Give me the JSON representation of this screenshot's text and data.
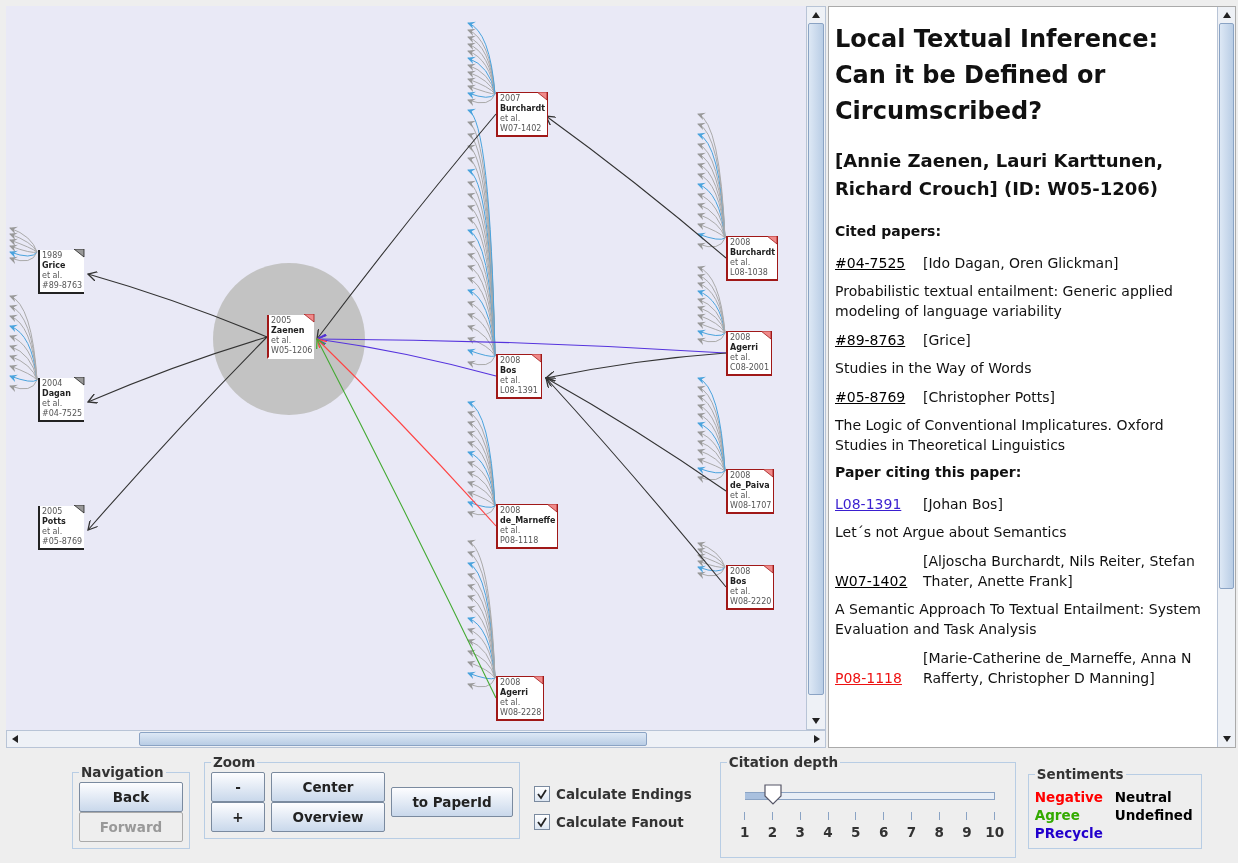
{
  "graph": {
    "nodes": [
      {
        "year": "1989",
        "author": "Grice",
        "etal": "et al.",
        "id": "#89-8763",
        "kind": "cited"
      },
      {
        "year": "2004",
        "author": "Dagan",
        "etal": "et al.",
        "id": "#04-7525",
        "kind": "cited"
      },
      {
        "year": "2005",
        "author": "Potts",
        "etal": "et al.",
        "id": "#05-8769",
        "kind": "cited"
      },
      {
        "year": "2005",
        "author": "Zaenen",
        "etal": "et al.",
        "id": "W05-1206",
        "kind": "focus"
      },
      {
        "year": "2007",
        "author": "Burchardt",
        "etal": "et al.",
        "id": "W07-1402",
        "kind": "citing"
      },
      {
        "year": "2008",
        "author": "Bos",
        "etal": "et al.",
        "id": "L08-1391",
        "kind": "citing"
      },
      {
        "year": "2008",
        "author": "de_Marneffe",
        "etal": "et al.",
        "id": "P08-1118",
        "kind": "citing"
      },
      {
        "year": "2008",
        "author": "Agerri",
        "etal": "et al.",
        "id": "W08-2228",
        "kind": "citing"
      },
      {
        "year": "2008",
        "author": "Burchardt",
        "etal": "et al.",
        "id": "L08-1038",
        "kind": "citing"
      },
      {
        "year": "2008",
        "author": "Agerri",
        "etal": "et al.",
        "id": "C08-2001",
        "kind": "citing"
      },
      {
        "year": "2008",
        "author": "de_Paiva",
        "etal": "et al.",
        "id": "W08-1707",
        "kind": "citing"
      },
      {
        "year": "2008",
        "author": "Bos",
        "etal": "et al.",
        "id": "W08-2220",
        "kind": "citing"
      }
    ]
  },
  "details": {
    "title": "Local Textual Inference: Can it be Defined or Circumscribed?",
    "authors": "[Annie Zaenen, Lauri Karttunen, Richard Crouch] (ID: W05-1206)",
    "sections": [
      {
        "heading": "Cited papers:",
        "papers": [
          {
            "id": "#04-7525",
            "authors": "[Ido Dagan, Oren Glickman]",
            "title": "Probabilistic textual entailment: Generic applied modeling of language variability",
            "color": "#000000"
          },
          {
            "id": "#89-8763",
            "authors": "[Grice]",
            "title": "Studies in the Way of Words",
            "color": "#000000"
          },
          {
            "id": "#05-8769",
            "authors": "[Christopher Potts]",
            "title": "The Logic of Conventional Implicatures. Oxford Studies in Theoretical Linguistics",
            "color": "#000000"
          }
        ]
      },
      {
        "heading": "Paper citing this paper:",
        "papers": [
          {
            "id": "L08-1391",
            "authors": "[Johan Bos]",
            "title": "Let´s not Argue about Semantics",
            "color": "#3a1fd0"
          },
          {
            "id": "W07-1402",
            "authors": "[Aljoscha Burchardt, Nils Reiter, Stefan Thater, Anette Frank]",
            "title": "A Semantic Approach To Textual Entailment: System Evaluation and Task Analysis",
            "color": "#000000"
          },
          {
            "id": "P08-1118",
            "authors": "[Marie-Catherine de_Marneffe, Anna N Rafferty, Christopher D Manning]",
            "color": "#ee1111"
          }
        ]
      }
    ]
  },
  "navigation": {
    "title": "Navigation",
    "buttons": [
      {
        "label": "Back",
        "disabled": false
      },
      {
        "label": "Forward",
        "disabled": true
      }
    ]
  },
  "zoom": {
    "title": "Zoom",
    "minus": "-",
    "plus": "+",
    "center": "Center",
    "overview": "Overview",
    "to_paper": "to PaperId"
  },
  "options": [
    {
      "label": "Calculate Endings",
      "checked": true
    },
    {
      "label": "Calculate Fanout",
      "checked": true
    }
  ],
  "citation_depth": {
    "title": "Citation depth",
    "level": 0.111,
    "ticks": [
      "1",
      "2",
      "3",
      "4",
      "5",
      "6",
      "7",
      "8",
      "9",
      "10"
    ]
  },
  "sentiments": {
    "title": "Sentiments",
    "items": [
      {
        "label": "Negative",
        "color": "#ff0000"
      },
      {
        "label": "Neutral",
        "color": "#000000"
      },
      {
        "label": "Agree",
        "color": "#33aa00"
      },
      {
        "label": "Undefined",
        "color": "#000000"
      },
      {
        "label": "PRecycle",
        "color": "#2200cc"
      }
    ]
  }
}
